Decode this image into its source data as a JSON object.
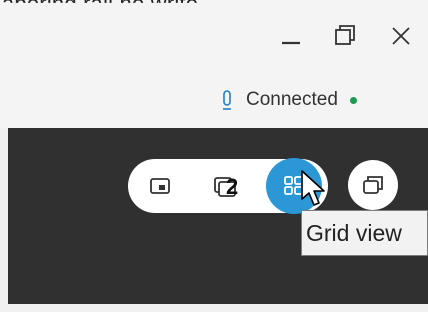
{
  "window": {
    "top_partial_text": "aboring rail no write",
    "controls": {
      "minimize_icon": "minimize-icon",
      "restore_icon": "restore-icon",
      "close_icon": "close-icon"
    }
  },
  "status": {
    "label": "Connected",
    "mic_icon": "microphone-icon",
    "dot_color": "#1f9a55"
  },
  "toolbar": {
    "badge_count": "2",
    "tooltip": "Grid view",
    "accent": "#2b97d4",
    "icons": [
      "picture-in-picture-icon",
      "stacked-screens-icon",
      "grid-view-icon",
      "float-window-icon"
    ]
  }
}
